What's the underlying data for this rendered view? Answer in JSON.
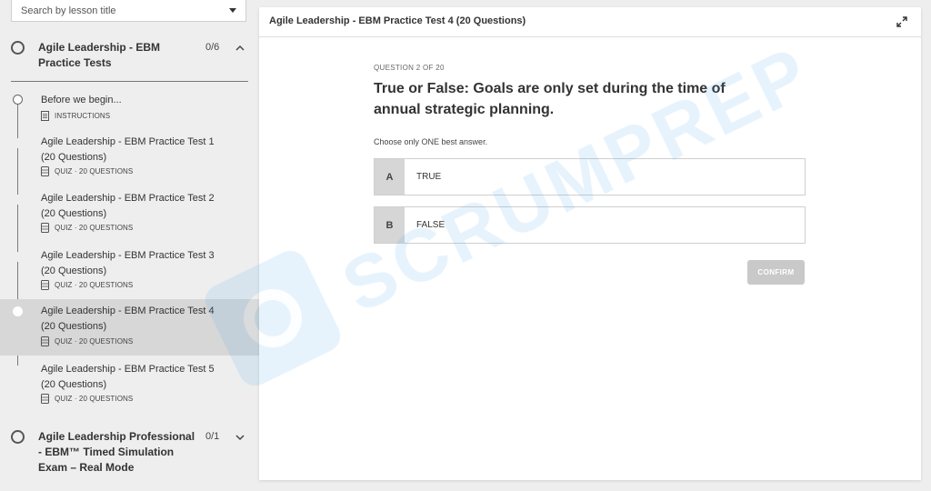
{
  "search": {
    "placeholder": "Search by lesson title",
    "icon": "chevron-down-icon"
  },
  "sidebar": {
    "sections": [
      {
        "title": "Agile Leadership - EBM Practice Tests",
        "count": "0/6",
        "expanded": true
      },
      {
        "title": "Agile Leadership Professional - EBM™ Timed Simulation Exam – Real Mode",
        "count": "0/1",
        "expanded": false
      }
    ],
    "lessons": [
      {
        "title": "Before we begin...",
        "meta": "INSTRUCTIONS",
        "icon": "document-icon",
        "active": false
      },
      {
        "title": "Agile Leadership - EBM Practice Test 1 (20 Questions)",
        "meta": "QUIZ · 20 QUESTIONS",
        "icon": "quiz-icon",
        "active": false
      },
      {
        "title": "Agile Leadership - EBM Practice Test 2 (20 Questions)",
        "meta": "QUIZ · 20 QUESTIONS",
        "icon": "quiz-icon",
        "active": false
      },
      {
        "title": "Agile Leadership - EBM Practice Test 3 (20 Questions)",
        "meta": "QUIZ · 20 QUESTIONS",
        "icon": "quiz-icon",
        "active": false
      },
      {
        "title": "Agile Leadership - EBM Practice Test 4 (20 Questions)",
        "meta": "QUIZ · 20 QUESTIONS",
        "icon": "quiz-icon",
        "active": true
      },
      {
        "title": "Agile Leadership - EBM Practice Test 5 (20 Questions)",
        "meta": "QUIZ · 20 QUESTIONS",
        "icon": "quiz-icon",
        "active": false
      }
    ]
  },
  "panel": {
    "title": "Agile Leadership - EBM Practice Test 4 (20 Questions)",
    "expand_icon": "expand-icon"
  },
  "question": {
    "counter": "QUESTION 2 OF 20",
    "text": "True or False: Goals are only set during the time of annual strategic planning.",
    "instruction": "Choose only ONE best answer.",
    "options": [
      {
        "letter": "A",
        "text": "TRUE"
      },
      {
        "letter": "B",
        "text": "FALSE"
      }
    ],
    "confirm_label": "CONFIRM"
  },
  "watermark": {
    "text": "SCRUMPREP",
    "color": "#3fa3e6"
  },
  "colors": {
    "active_row": "#d7d7d7",
    "confirm_disabled": "#c9c9c9",
    "option_letter_bg": "#d6d6d6"
  }
}
